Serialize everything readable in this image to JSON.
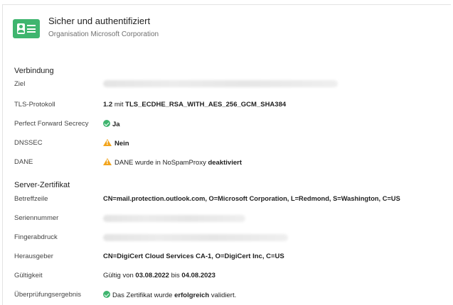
{
  "header": {
    "title": "Sicher und authentifiziert",
    "subtitle": "Organisation Microsoft Corporation",
    "icon": "id-card-icon",
    "accent_color": "#3fb56f"
  },
  "connection": {
    "section_title": "Verbindung",
    "rows": {
      "target": {
        "label": "Ziel"
      },
      "tls": {
        "label": "TLS-Protokoll",
        "version": "1.2",
        "joiner": "mit",
        "cipher": "TLS_ECDHE_RSA_WITH_AES_256_GCM_SHA384"
      },
      "pfs": {
        "label": "Perfect Forward Secrecy",
        "value": "Ja",
        "icon": "check-circle-icon"
      },
      "dnssec": {
        "label": "DNSSEC",
        "value": "Nein",
        "icon": "warning-icon"
      },
      "dane": {
        "label": "DANE",
        "text": "DANE wurde in NoSpamProxy",
        "emphasis": "deaktiviert",
        "icon": "warning-icon"
      }
    }
  },
  "certificate": {
    "section_title": "Server-Zertifikat",
    "rows": {
      "subject": {
        "label": "Betreffzeile",
        "value": "CN=mail.protection.outlook.com, O=Microsoft Corporation, L=Redmond, S=Washington, C=US"
      },
      "serial": {
        "label": "Seriennummer"
      },
      "fingerprint": {
        "label": "Fingerabdruck"
      },
      "issuer": {
        "label": "Herausgeber",
        "value": "CN=DigiCert Cloud Services CA-1, O=DigiCert Inc, C=US"
      },
      "validity": {
        "label": "Gültigkeit",
        "prefix": "Gültig von",
        "from": "03.08.2022",
        "middle": "bis",
        "to": "04.08.2023"
      },
      "verification": {
        "label": "Überprüfungsergebnis",
        "text_before": "Das Zertifikat wurde",
        "emphasis": "erfolgreich",
        "text_after": "validiert.",
        "icon": "check-circle-icon"
      }
    }
  },
  "colors": {
    "success": "#3fb56f",
    "warning": "#f2a41c"
  }
}
